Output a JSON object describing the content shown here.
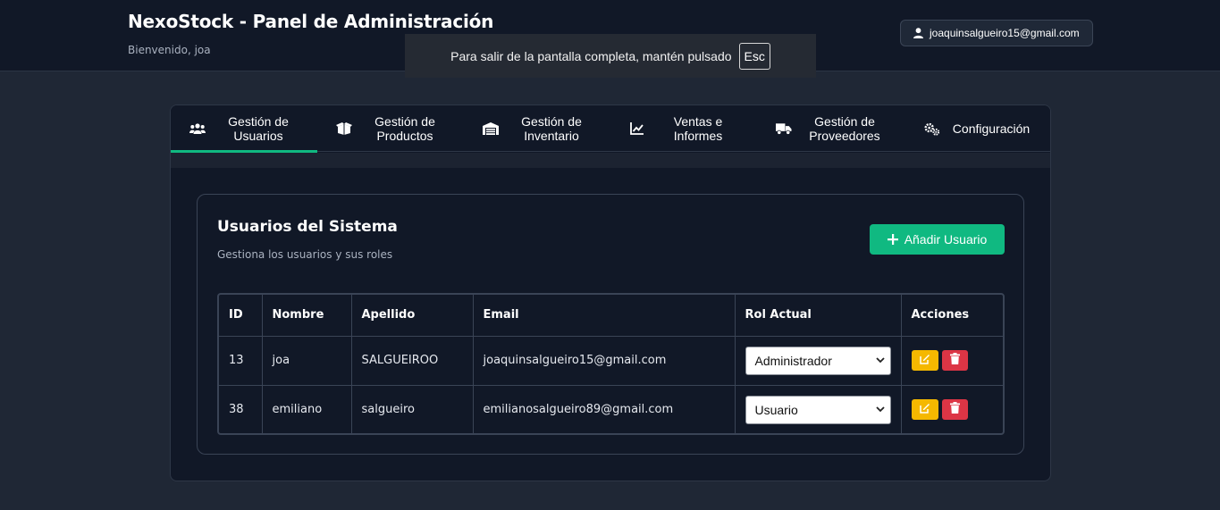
{
  "header": {
    "title": "NexoStock - Panel de Administración",
    "welcome": "Bienvenido, joa",
    "user_email": "joaquinsalgueiro15@gmail.com",
    "user_icon": "user-icon"
  },
  "fullscreen_notice": {
    "message": "Para salir de la pantalla completa, mantén pulsado",
    "key": "Esc"
  },
  "tabs": [
    {
      "label": "Gestión de Usuarios",
      "icon": "users-icon",
      "active": true
    },
    {
      "label": "Gestión de Productos",
      "icon": "boxes-icon",
      "active": false
    },
    {
      "label": "Gestión de Inventario",
      "icon": "warehouse-icon",
      "active": false
    },
    {
      "label": "Ventas e Informes",
      "icon": "chart-line-icon",
      "active": false
    },
    {
      "label": "Gestión de Proveedores",
      "icon": "truck-icon",
      "active": false
    },
    {
      "label": "Configuración",
      "icon": "gears-icon",
      "active": false
    }
  ],
  "users_card": {
    "title": "Usuarios del Sistema",
    "subtitle": "Gestiona los usuarios y sus roles",
    "add_button": "Añadir Usuario",
    "columns": [
      "ID",
      "Nombre",
      "Apellido",
      "Email",
      "Rol Actual",
      "Acciones"
    ],
    "rows": [
      {
        "id": "13",
        "nombre": "joa",
        "apellido": "SALGUEIROO",
        "email": "joaquinsalgueiro15@gmail.com",
        "rol": "Administrador"
      },
      {
        "id": "38",
        "nombre": "emiliano",
        "apellido": "salgueiro",
        "email": "emilianosalgueiro89@gmail.com",
        "rol": "Usuario"
      }
    ]
  },
  "colors": {
    "accent": "#10b981",
    "edit": "#f5b800",
    "delete": "#dc3545",
    "background": "#1f2735",
    "panel": "#111827"
  }
}
